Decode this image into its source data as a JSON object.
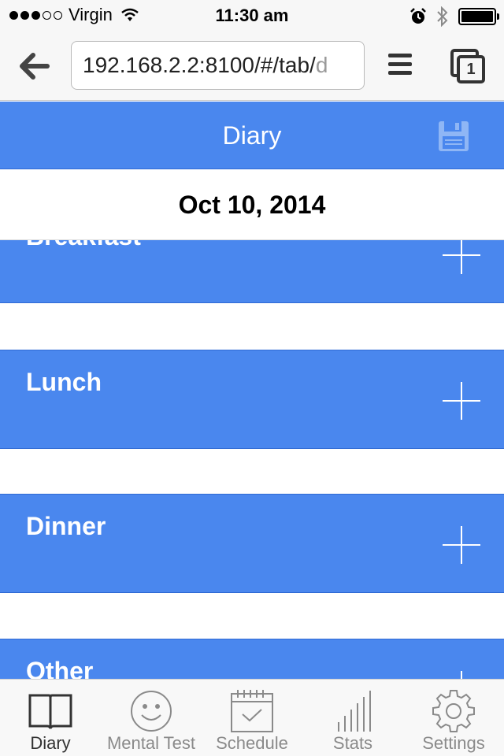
{
  "status_bar": {
    "carrier": "Virgin",
    "time": "11:30 am",
    "signal_bars": 3,
    "battery_level": 1.0
  },
  "browser": {
    "url_main": "192.168.2.2:8100/#/tab/",
    "url_faded": "d",
    "tabs_count": "1"
  },
  "header": {
    "title": "Diary"
  },
  "date": "Oct 10, 2014",
  "meals": [
    {
      "label": "Breakfast"
    },
    {
      "label": "Lunch"
    },
    {
      "label": "Dinner"
    },
    {
      "label": "Other"
    }
  ],
  "tabs": [
    {
      "label": "Diary",
      "icon": "book-icon",
      "active": true
    },
    {
      "label": "Mental Test",
      "icon": "smiley-icon",
      "active": false
    },
    {
      "label": "Schedule",
      "icon": "calendar-icon",
      "active": false
    },
    {
      "label": "Stats",
      "icon": "stats-icon",
      "active": false
    },
    {
      "label": "Settings",
      "icon": "gear-icon",
      "active": false
    }
  ],
  "colors": {
    "accent": "#4a87ee",
    "accent_border": "#2f6ad4",
    "tab_active": "#333333",
    "tab_inactive": "#8a8a8a"
  }
}
